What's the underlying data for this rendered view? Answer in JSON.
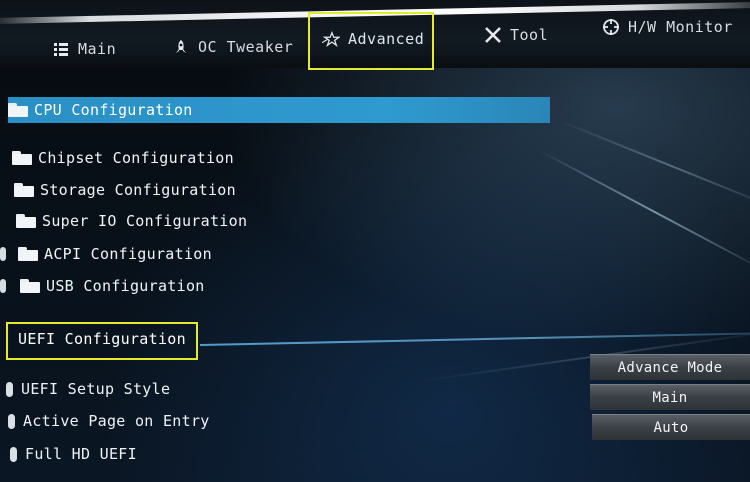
{
  "tabs": {
    "main": {
      "label": "Main",
      "icon": "list-icon"
    },
    "oc_tweaker": {
      "label": "OC Tweaker",
      "icon": "rocket-icon"
    },
    "advanced": {
      "label": "Advanced",
      "icon": "star-icon"
    },
    "tool": {
      "label": "Tool",
      "icon": "tools-icon"
    },
    "hw_monitor": {
      "label": "H/W Monitor",
      "icon": "crosshair-icon"
    }
  },
  "menu": {
    "items": [
      {
        "label": "CPU Configuration"
      },
      {
        "label": "Chipset Configuration"
      },
      {
        "label": "Storage Configuration"
      },
      {
        "label": "Super IO Configuration"
      },
      {
        "label": "ACPI Configuration"
      },
      {
        "label": "USB Configuration"
      }
    ]
  },
  "section": {
    "title": "UEFI Configuration"
  },
  "settings": {
    "uefi_setup_style": {
      "label": "UEFI Setup Style",
      "value": "Advance Mode"
    },
    "active_page": {
      "label": "Active Page on Entry",
      "value": "Main"
    },
    "full_hd_uefi": {
      "label": "Full HD UEFI",
      "value": "Auto"
    }
  },
  "colors": {
    "selected": "#2f9ad0",
    "highlight_box": "#e5ea2a",
    "background": "#05080c"
  }
}
